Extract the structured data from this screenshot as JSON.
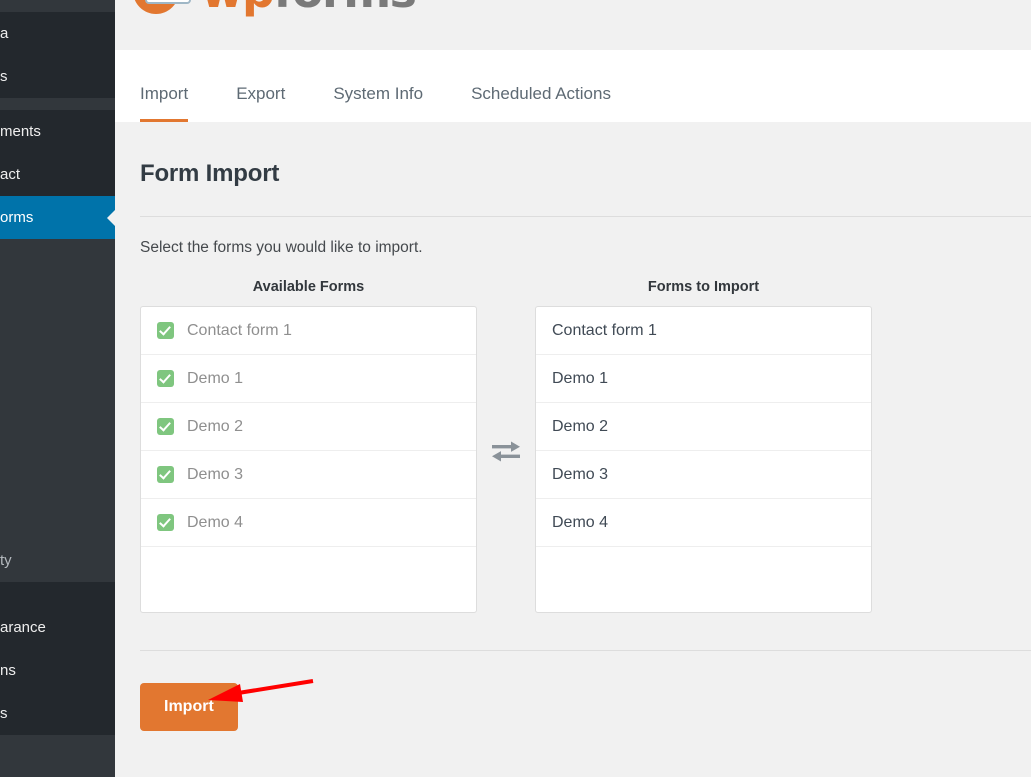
{
  "sidebar": {
    "items": [
      {
        "label": "a",
        "state": "normal",
        "group": 1
      },
      {
        "label": "s",
        "state": "normal",
        "group": 1
      },
      {
        "label": "ments",
        "state": "normal",
        "group": 2
      },
      {
        "label": "act",
        "state": "normal",
        "group": 2
      },
      {
        "label": "orms",
        "state": "current",
        "group": 2
      },
      {
        "label": "ty",
        "state": "dim",
        "group": 3
      },
      {
        "label": "arance",
        "state": "normal",
        "group": 4
      },
      {
        "label": "ns",
        "state": "normal",
        "group": 4
      },
      {
        "label": "s",
        "state": "normal",
        "group": 4
      }
    ],
    "current_color": "#0073aa",
    "background": "#32373c"
  },
  "brand": {
    "logo_word_1": "wp",
    "logo_word_2": "forms",
    "accent_color": "#e27730"
  },
  "tabs": [
    {
      "label": "Import",
      "active": true
    },
    {
      "label": "Export",
      "active": false
    },
    {
      "label": "System Info",
      "active": false
    },
    {
      "label": "Scheduled Actions",
      "active": false
    }
  ],
  "page": {
    "title": "Form Import",
    "lead": "Select the forms you would like to import."
  },
  "transfer": {
    "available": {
      "title": "Available Forms",
      "items": [
        {
          "label": "Contact form 1",
          "checked": true
        },
        {
          "label": "Demo 1",
          "checked": true
        },
        {
          "label": "Demo 2",
          "checked": true
        },
        {
          "label": "Demo 3",
          "checked": true
        },
        {
          "label": "Demo 4",
          "checked": true
        }
      ]
    },
    "selected": {
      "title": "Forms to Import",
      "items": [
        {
          "label": "Contact form 1"
        },
        {
          "label": "Demo 1"
        },
        {
          "label": "Demo 2"
        },
        {
          "label": "Demo 3"
        },
        {
          "label": "Demo 4"
        }
      ]
    },
    "swap_icon": "exchange-arrows-icon",
    "checkbox_color": "#7fc67f"
  },
  "actions": {
    "import_label": "Import",
    "import_color": "#e27730"
  },
  "annotation": {
    "arrow_color": "#ff0000",
    "points_to": "import-button"
  }
}
